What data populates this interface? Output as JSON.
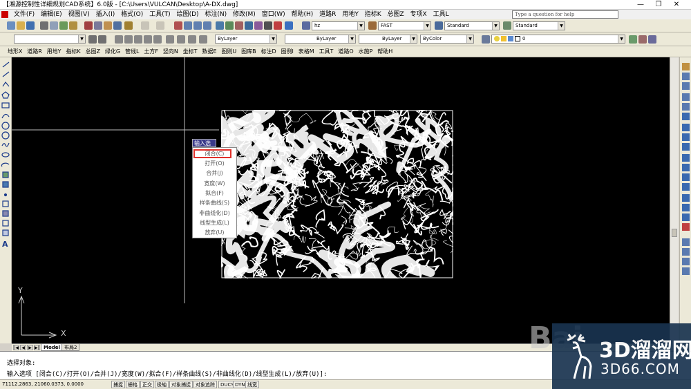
{
  "title": {
    "text": "【湘源控制性详细规划CAD系统】6.0版 - [C:\\Users\\VULCAN\\Desktop\\A-DX.dwg]",
    "minimize": "—",
    "maximize": "❐",
    "close": "✕"
  },
  "menubar": {
    "items": [
      "文件(F)",
      "编辑(E)",
      "视图(V)",
      "插入(I)",
      "格式(O)",
      "工具(T)",
      "绘图(D)",
      "标注(N)",
      "修改(M)",
      "窗口(W)",
      "帮助(H)",
      "道路R",
      "用地Y",
      "指标K",
      "总图Z",
      "专项X",
      "工具L"
    ],
    "help_placeholder": "Type a question for help"
  },
  "toolbar_styles": {
    "layer_combo": "hz",
    "text_style": "FAST",
    "dim_style": "Standard",
    "table_style": "Standard"
  },
  "toolbar_props": {
    "layer_color": "ByLayer",
    "linetype": "ByLayer",
    "lineweight": "ByLayer",
    "plotstyle": "ByColor",
    "layer_state": "0"
  },
  "custom_menu": {
    "items": [
      "地形X",
      "道路R",
      "用地Y",
      "指标K",
      "总图Z",
      "绿化G",
      "管线L",
      "土方F",
      "竖向N",
      "坐标T",
      "数据E",
      "图则U",
      "图库B",
      "标注D",
      "图例I",
      "表格M",
      "工具T",
      "道路O",
      "水施P",
      "帮助H"
    ]
  },
  "canvas": {
    "background": "#000000",
    "ucs_y": "Y",
    "ucs_x": "X"
  },
  "context_menu": {
    "title": "输入选项",
    "options": [
      "闭合(C)",
      "打开(O)",
      "合并(J)",
      "宽度(W)",
      "拟合(F)",
      "样条曲线(S)",
      "非曲线化(D)",
      "线型生成(L)",
      "放弃(U)"
    ],
    "highlight_color": "#e0302a"
  },
  "layout_tabs": {
    "nav": [
      "|◀",
      "◀",
      "▶",
      "▶|"
    ],
    "tabs": [
      "Model",
      "布局2"
    ]
  },
  "command": {
    "line1": "选择对象:",
    "line2": "输入选项 [闭合(C)/打开(O)/合并(J)/宽度(W)/拟合(F)/样条曲线(S)/非曲线化(D)/线型生成(L)/放弃(U)]:"
  },
  "statusbar": {
    "coords": "71112.2863, 21060.0373, 0.0000",
    "buttons": [
      "捕捉",
      "栅格",
      "正交",
      "极轴",
      "对象捕捉",
      "对象追踪",
      "DUCS",
      "DYN",
      "线宽"
    ]
  },
  "watermark": {
    "main": "3D溜溜网",
    "sub": "3D66.COM",
    "bai": "Bai"
  },
  "colors": {
    "canvas": "#000000",
    "chrome": "#ece9d8",
    "ctx_title_bg": "#3a3a8a",
    "watermark_bg": "#1a3450"
  }
}
